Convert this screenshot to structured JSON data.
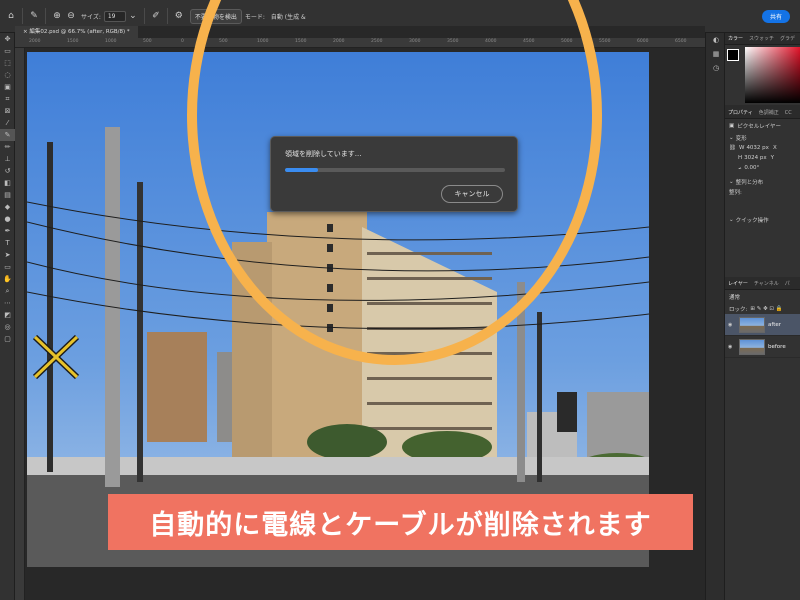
{
  "options_bar": {
    "size_label": "サイズ:",
    "size_value": "19",
    "detect_button": "不要な物を検出",
    "mode_label": "モード:",
    "mode_value": "自動 (生成 &",
    "share_label": "共有"
  },
  "document_tab": {
    "title": "編集02.psd @ 66.7% (after, RGB/8) *"
  },
  "ruler_ticks": [
    "2000",
    "1500",
    "1000",
    "500",
    "0",
    "500",
    "1000",
    "1500",
    "2000",
    "2500",
    "3000",
    "3500",
    "4000",
    "4500",
    "5000",
    "5500",
    "6000",
    "6500"
  ],
  "progress_dialog": {
    "message": "領域を削除しています...",
    "progress": 0.15,
    "cancel_label": "キャンセル"
  },
  "right_panel": {
    "color_tabs": [
      "カラー",
      "スウォッチ",
      "グラデ"
    ],
    "properties_tabs": [
      "プロパティ",
      "色調補正",
      "CC"
    ],
    "pixel_layer_label": "ピクセルレイヤー",
    "transform_label": "変形",
    "width_label": "W",
    "width_value": "4032 px",
    "height_label": "H",
    "height_value": "3024 px",
    "x_label": "X",
    "y_label": "Y",
    "angle_value": "0.00°",
    "align_label": "整列と分布",
    "align_sub": "整列:",
    "quick_actions_label": "クイック操作",
    "layers_tabs": [
      "レイヤー",
      "チャンネル",
      "パ"
    ],
    "blend_mode": "通常",
    "lock_label": "ロック:",
    "layers": [
      {
        "name": "after",
        "selected": true
      },
      {
        "name": "before",
        "selected": false
      }
    ]
  },
  "caption": {
    "text": "自動的に電線とケーブルが削除されます"
  },
  "colors": {
    "highlight_ring": "#f7b24c",
    "caption_bg": "#f07361",
    "progress_fill": "#3a8cf0",
    "share_button": "#1473e6"
  }
}
